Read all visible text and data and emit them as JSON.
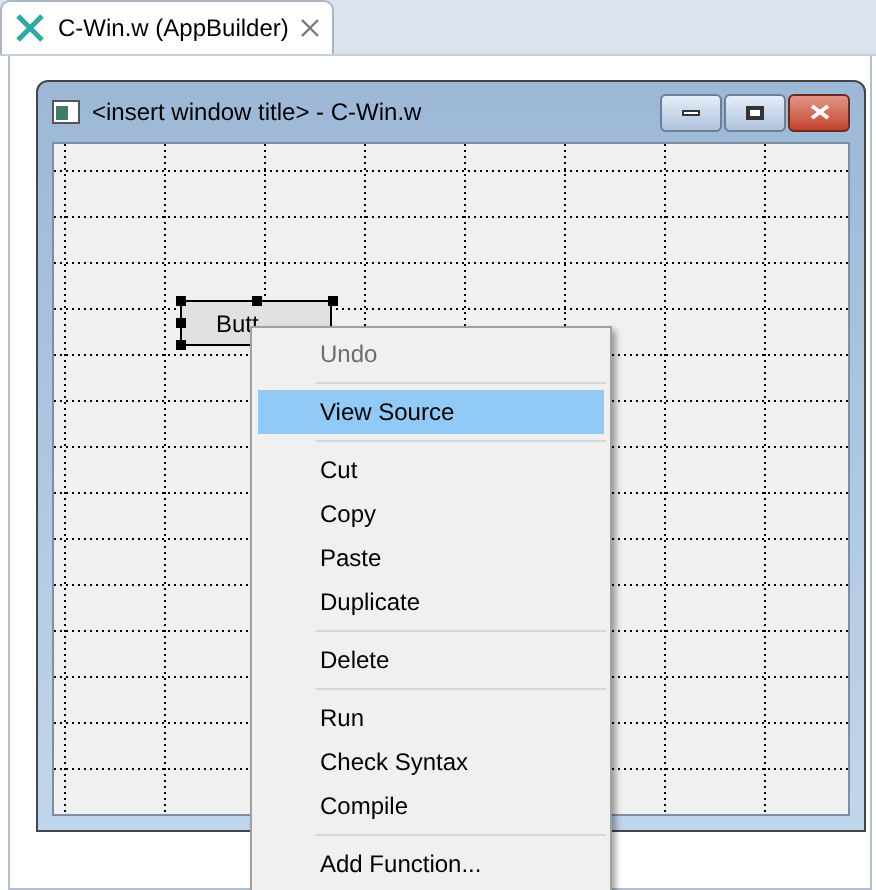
{
  "tabs": [
    {
      "label": "C-Win.w (AppBuilder)",
      "selected": true
    }
  ],
  "design_window": {
    "title": "<insert window title> - C-Win.w"
  },
  "widget": {
    "label": "Butt",
    "selected": true
  },
  "context_menu": [
    {
      "kind": "item",
      "label": "Undo",
      "disabled": true,
      "selected": false
    },
    {
      "kind": "separator"
    },
    {
      "kind": "item",
      "label": "View Source",
      "disabled": false,
      "selected": true
    },
    {
      "kind": "separator"
    },
    {
      "kind": "item",
      "label": "Cut",
      "disabled": false,
      "selected": false
    },
    {
      "kind": "item",
      "label": "Copy",
      "disabled": false,
      "selected": false
    },
    {
      "kind": "item",
      "label": "Paste",
      "disabled": false,
      "selected": false
    },
    {
      "kind": "item",
      "label": "Duplicate",
      "disabled": false,
      "selected": false
    },
    {
      "kind": "separator"
    },
    {
      "kind": "item",
      "label": "Delete",
      "disabled": false,
      "selected": false
    },
    {
      "kind": "separator"
    },
    {
      "kind": "item",
      "label": "Run",
      "disabled": false,
      "selected": false
    },
    {
      "kind": "item",
      "label": "Check Syntax",
      "disabled": false,
      "selected": false
    },
    {
      "kind": "item",
      "label": "Compile",
      "disabled": false,
      "selected": false
    },
    {
      "kind": "separator"
    },
    {
      "kind": "item",
      "label": "Add Function...",
      "disabled": false,
      "selected": false
    }
  ]
}
